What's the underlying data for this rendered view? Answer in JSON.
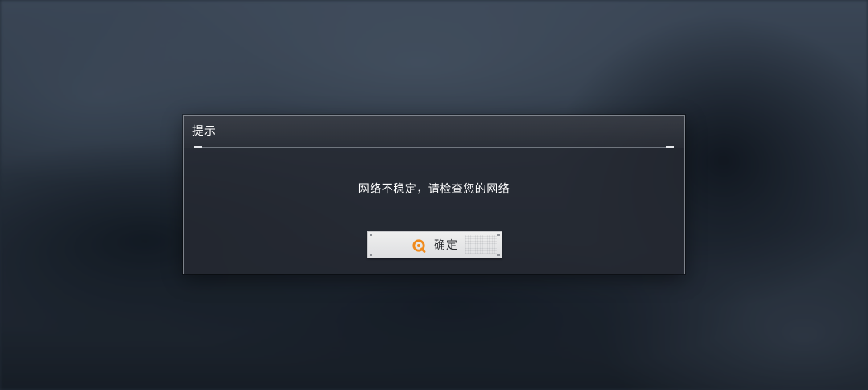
{
  "dialog": {
    "title": "提示",
    "message": "网络不稳定，请检查您的网络",
    "confirm_label": "确定",
    "confirm_icon": "circle-q-icon"
  },
  "colors": {
    "accent": "#f08a1c",
    "dialog_bg": "#262a32",
    "button_bg": "#e8e8ea"
  }
}
